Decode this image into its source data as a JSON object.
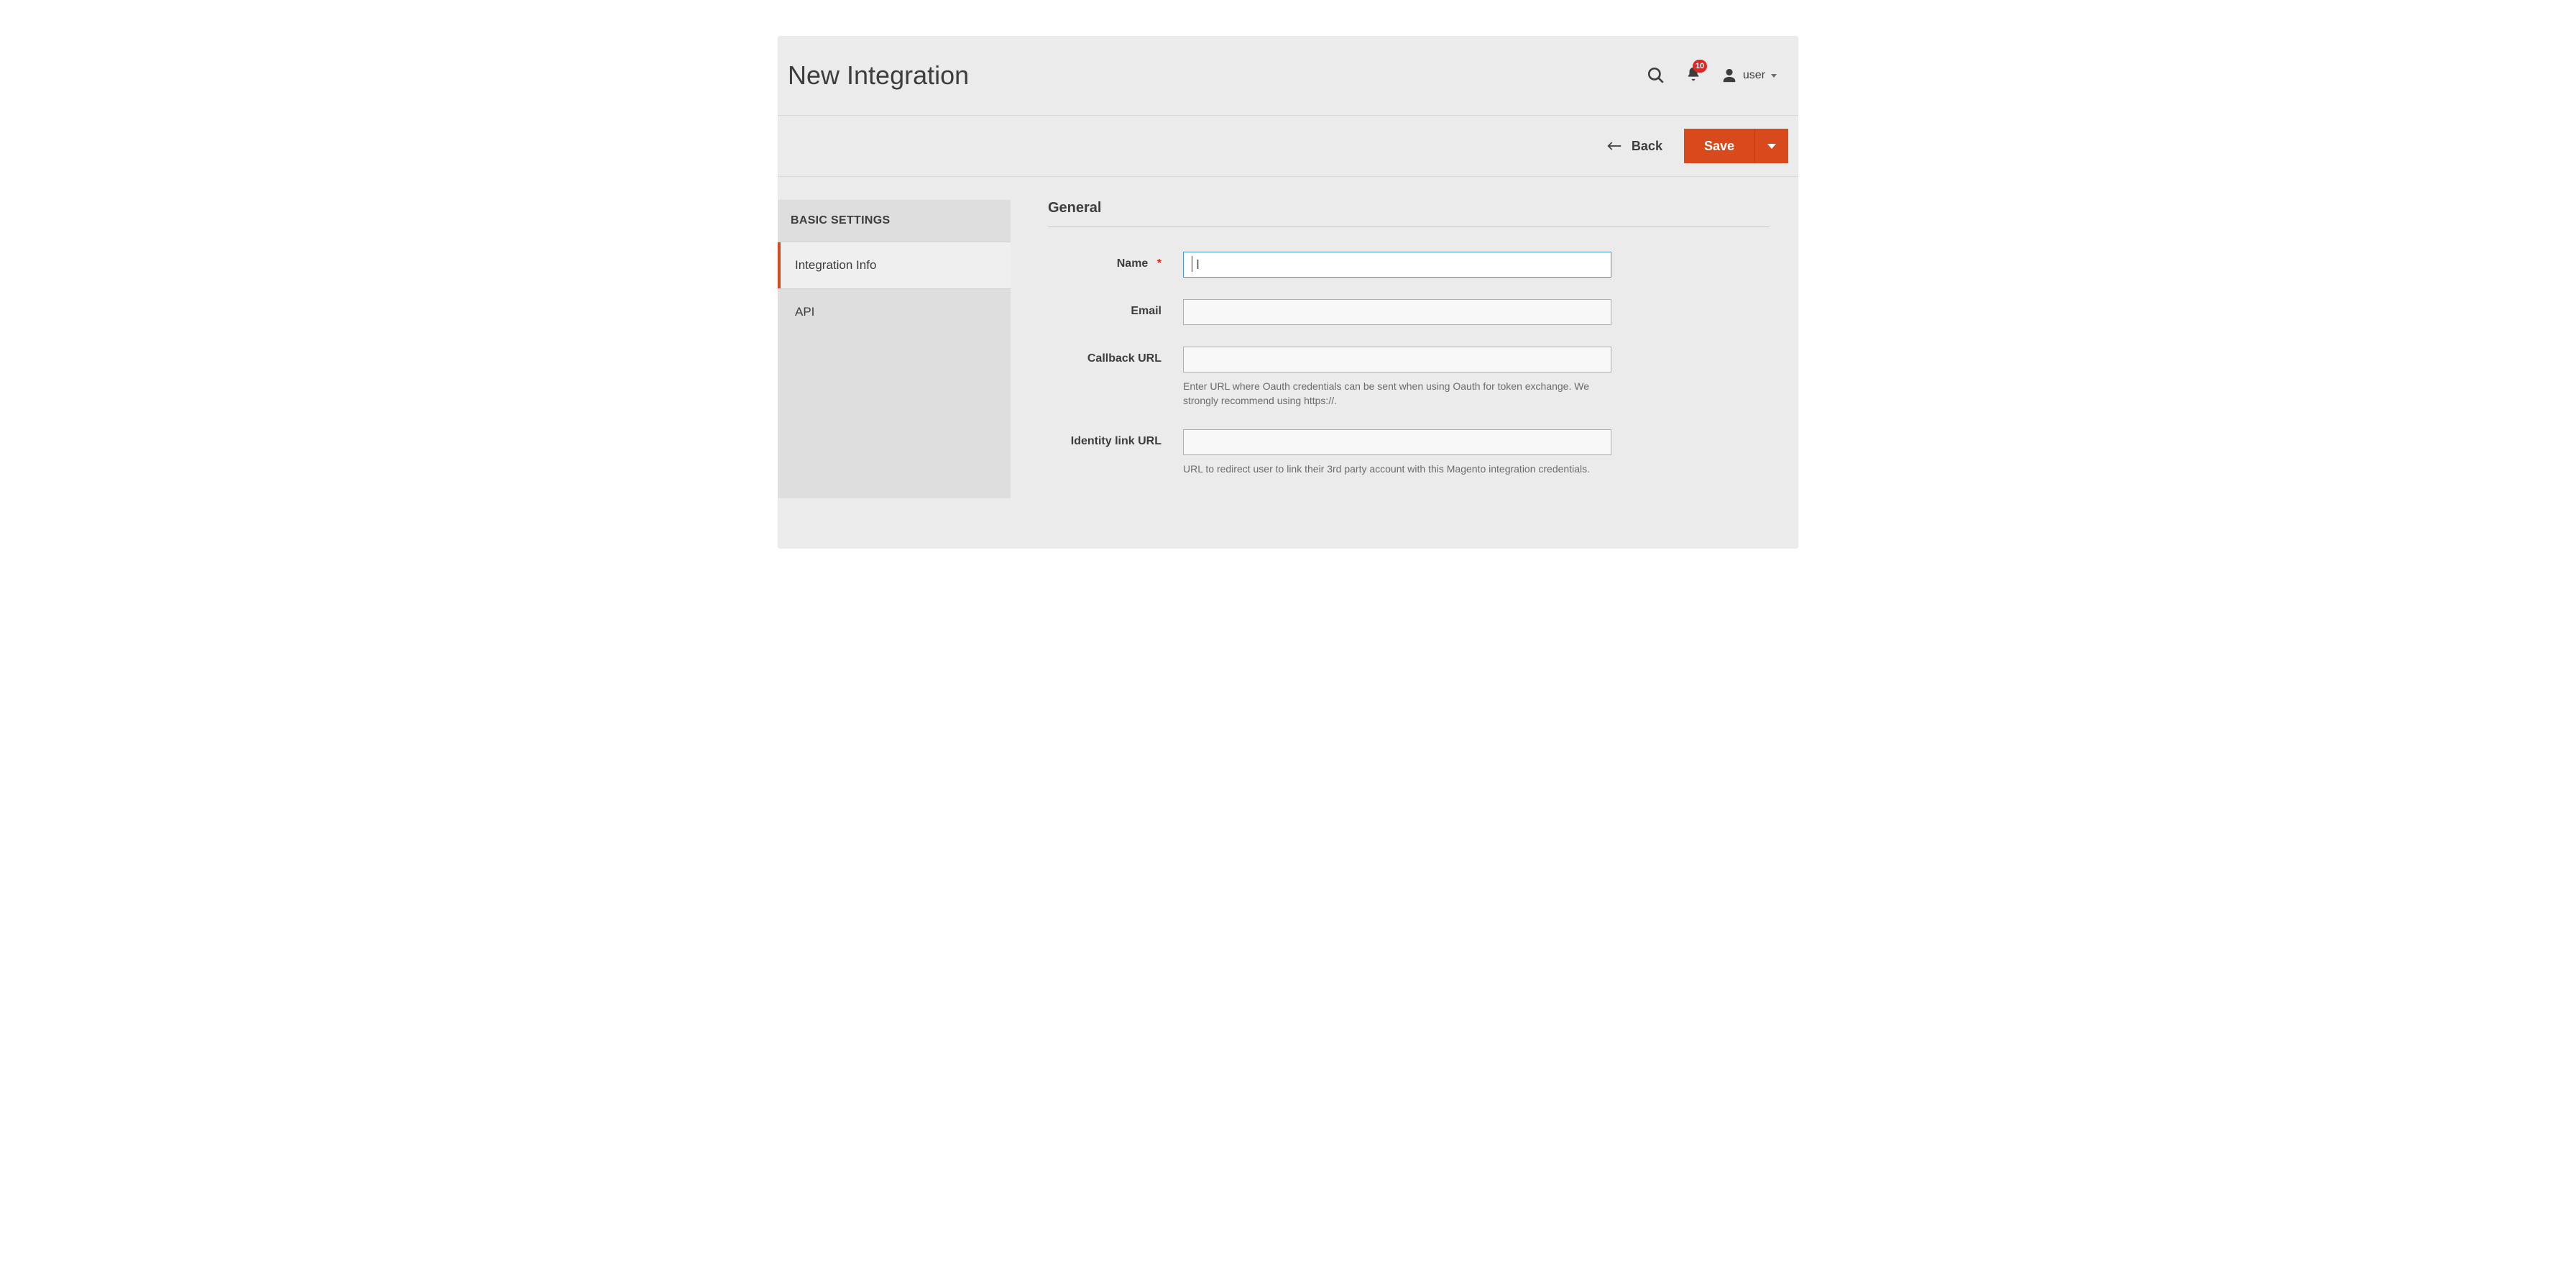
{
  "header": {
    "title": "New Integration",
    "notif_count": "10",
    "user_label": "user"
  },
  "actions": {
    "back_label": "Back",
    "save_label": "Save"
  },
  "sidebar": {
    "heading": "BASIC SETTINGS",
    "items": [
      {
        "label": "Integration Info",
        "active": true
      },
      {
        "label": "API",
        "active": false
      }
    ]
  },
  "form": {
    "section_title": "General",
    "fields": {
      "name": {
        "label": "Name",
        "required": true,
        "value": ""
      },
      "email": {
        "label": "Email",
        "required": false,
        "value": ""
      },
      "callback_url": {
        "label": "Callback URL",
        "required": false,
        "value": "",
        "hint": "Enter URL where Oauth credentials can be sent when using Oauth for token exchange. We strongly recommend using https://."
      },
      "identity_url": {
        "label": "Identity link URL",
        "required": false,
        "value": "",
        "hint": "URL to redirect user to link their 3rd party account with this Magento integration credentials."
      }
    }
  }
}
